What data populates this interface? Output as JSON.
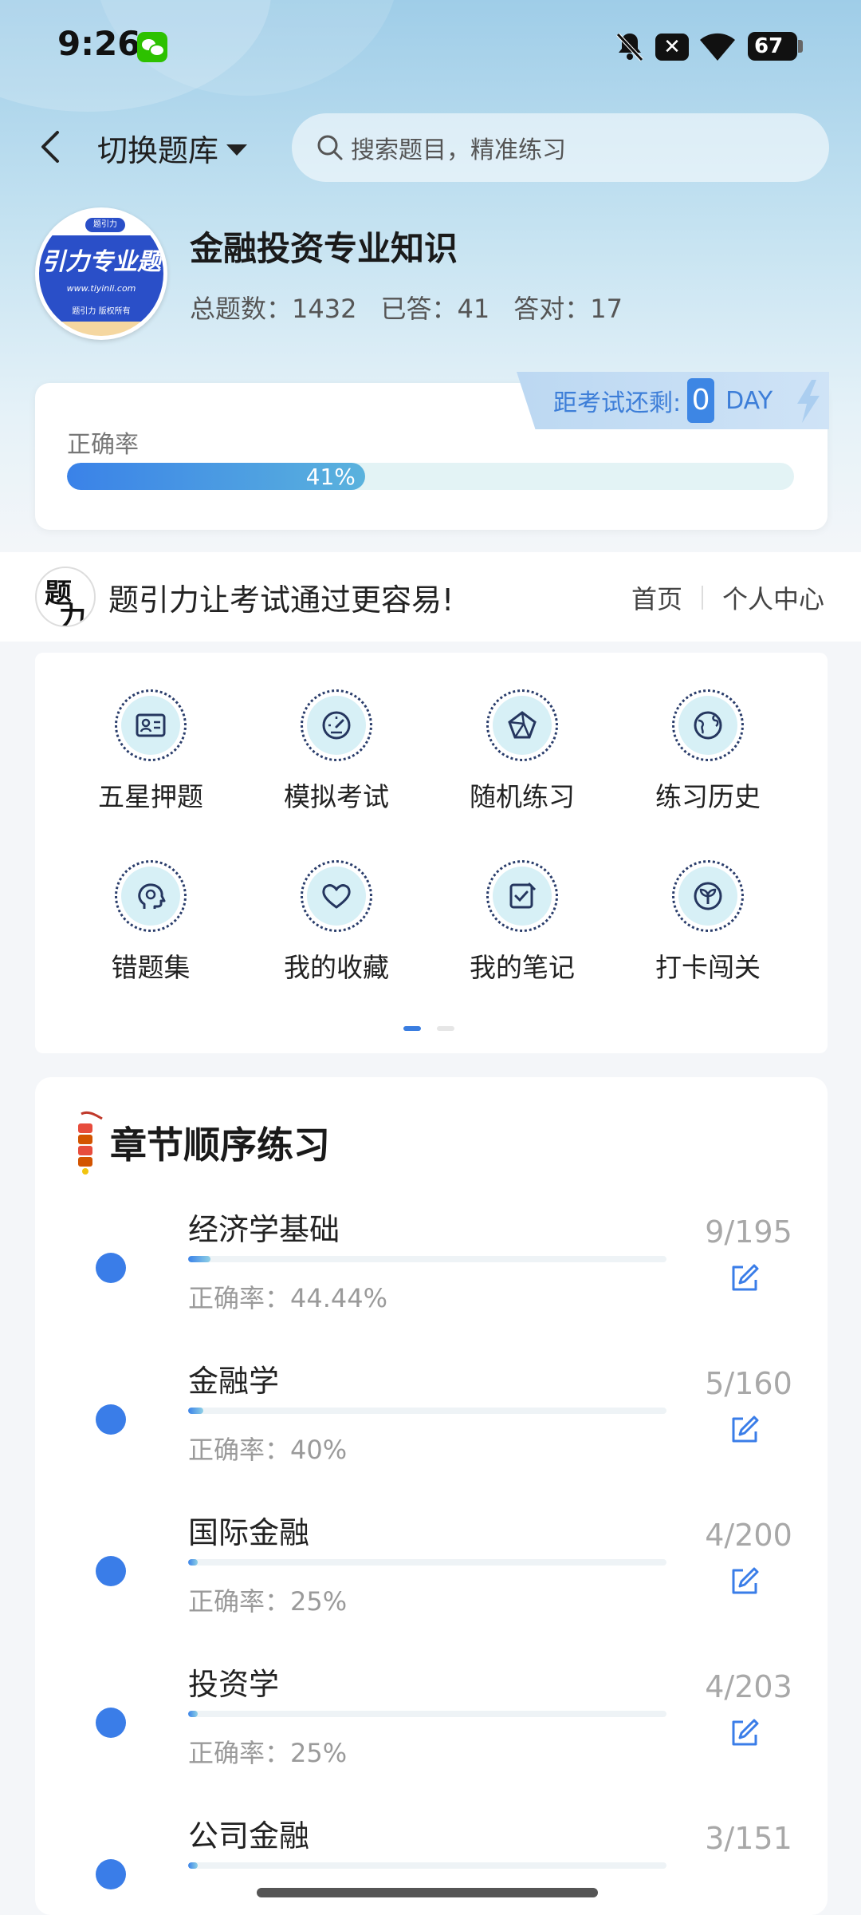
{
  "status_bar": {
    "time": "9:26",
    "battery": "67",
    "close_glyph": "✕"
  },
  "nav": {
    "switch_label": "切换题库",
    "search_placeholder": "搜索题目，精准练习"
  },
  "book": {
    "logo_text": "引力专业题",
    "logo_url": "www.tiyinli.com",
    "logo_copyright": "题引力 版权所有",
    "logo_top": "题引力",
    "title": "金融投资专业知识",
    "stats": [
      {
        "label": "总题数：",
        "value": "1432"
      },
      {
        "label": "已答：",
        "value": "41"
      },
      {
        "label": "答对：",
        "value": "17"
      }
    ]
  },
  "exam": {
    "label": "距考试还剩:",
    "days": "0",
    "unit": "DAY"
  },
  "accuracy": {
    "label": "正确率",
    "percent_text": "41%",
    "percent": 41
  },
  "banner": {
    "slogan": "题引力让考试通过更容易!",
    "links": [
      "首页",
      "个人中心"
    ]
  },
  "menu": {
    "items": [
      {
        "label": "五星押题",
        "icon": "id-card-icon"
      },
      {
        "label": "模拟考试",
        "icon": "gauge-icon"
      },
      {
        "label": "随机练习",
        "icon": "polyhedron-icon"
      },
      {
        "label": "练习历史",
        "icon": "globe-icon"
      },
      {
        "label": "错题集",
        "icon": "brain-head-icon"
      },
      {
        "label": "我的收藏",
        "icon": "heart-icon"
      },
      {
        "label": "我的笔记",
        "icon": "note-check-icon"
      },
      {
        "label": "打卡闯关",
        "icon": "sprout-icon"
      }
    ],
    "page_count": 2,
    "active_page": 0
  },
  "chapters": {
    "title": "章节顺序练习",
    "items": [
      {
        "name": "经济学基础",
        "rate": "正确率：44.44%",
        "count": "9/195",
        "done": 9,
        "total": 195
      },
      {
        "name": "金融学",
        "rate": "正确率：40%",
        "count": "5/160",
        "done": 5,
        "total": 160
      },
      {
        "name": "国际金融",
        "rate": "正确率：25%",
        "count": "4/200",
        "done": 4,
        "total": 200
      },
      {
        "name": "投资学",
        "rate": "正确率：25%",
        "count": "4/203",
        "done": 4,
        "total": 203
      },
      {
        "name": "公司金融",
        "rate": "",
        "count": "3/151",
        "done": 3,
        "total": 151
      }
    ]
  },
  "colors": {
    "accent": "#3a7de8",
    "bar_track": "#e3f3f5",
    "menu_icon_bg": "#d7f0f6"
  }
}
